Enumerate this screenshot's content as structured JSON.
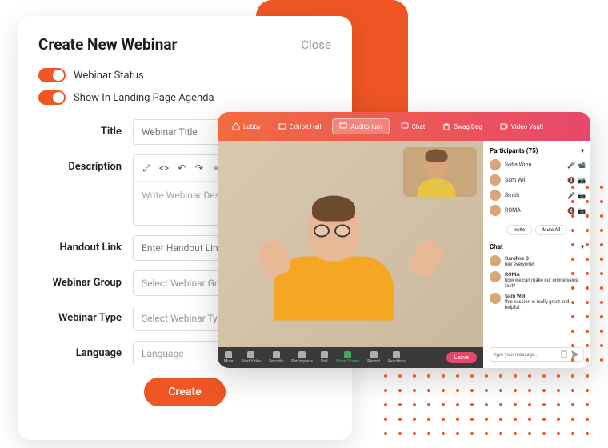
{
  "modal": {
    "title": "Create New Webinar",
    "close": "Close",
    "toggles": [
      {
        "label": "Webinar Status"
      },
      {
        "label": "Show In Landing Page Agenda"
      }
    ],
    "fields": {
      "title": {
        "label": "Title",
        "placeholder": "Webinar Title"
      },
      "description": {
        "label": "Description",
        "placeholder": "Write Webinar Description"
      },
      "handout": {
        "label": "Handout Link",
        "placeholder": "Enter Handout Link"
      },
      "group": {
        "label": "Webinar Group",
        "placeholder": "Select Webinar Group"
      },
      "type": {
        "label": "Webinar Type",
        "placeholder": "Select Webinar Type"
      },
      "language": {
        "label": "Language",
        "placeholder": "Language"
      }
    },
    "create_btn": "Create"
  },
  "webinar": {
    "nav": [
      {
        "icon": "home-icon",
        "label": "Lobby"
      },
      {
        "icon": "booth-icon",
        "label": "Exhibit Hall"
      },
      {
        "icon": "screen-icon",
        "label": "Auditorium",
        "active": true
      },
      {
        "icon": "chat-icon",
        "label": "Chat"
      },
      {
        "icon": "bag-icon",
        "label": "Swag Bag"
      },
      {
        "icon": "video-icon",
        "label": "Video Vault"
      }
    ],
    "controls": [
      {
        "label": "Mute"
      },
      {
        "label": "Start Video"
      },
      {
        "label": "Security"
      },
      {
        "label": "Participants"
      },
      {
        "label": "Poll"
      },
      {
        "label": "Share Screen",
        "green": true
      },
      {
        "label": "Record"
      },
      {
        "label": "Reactions"
      }
    ],
    "leave": "Leave",
    "participants_title": "Participants (75)",
    "participants": [
      {
        "name": "Sofia Wion",
        "mic": "on",
        "cam": "on"
      },
      {
        "name": "Sam Will",
        "mic": "off",
        "cam": "off"
      },
      {
        "name": "Smith",
        "mic": "on",
        "cam": "off"
      },
      {
        "name": "ROMA",
        "mic": "off",
        "cam": "off"
      }
    ],
    "tabs": {
      "invite": "Invite",
      "muteall": "Mute All"
    },
    "chat_title": "Chat",
    "chat": [
      {
        "name": "Caroline D",
        "text": "hey everyone!"
      },
      {
        "name": "ROMA",
        "text": "how we can make our online sales fast?"
      },
      {
        "name": "Sam Will",
        "text": "this session is really great and helpful."
      }
    ],
    "chat_placeholder": "type your message..."
  }
}
